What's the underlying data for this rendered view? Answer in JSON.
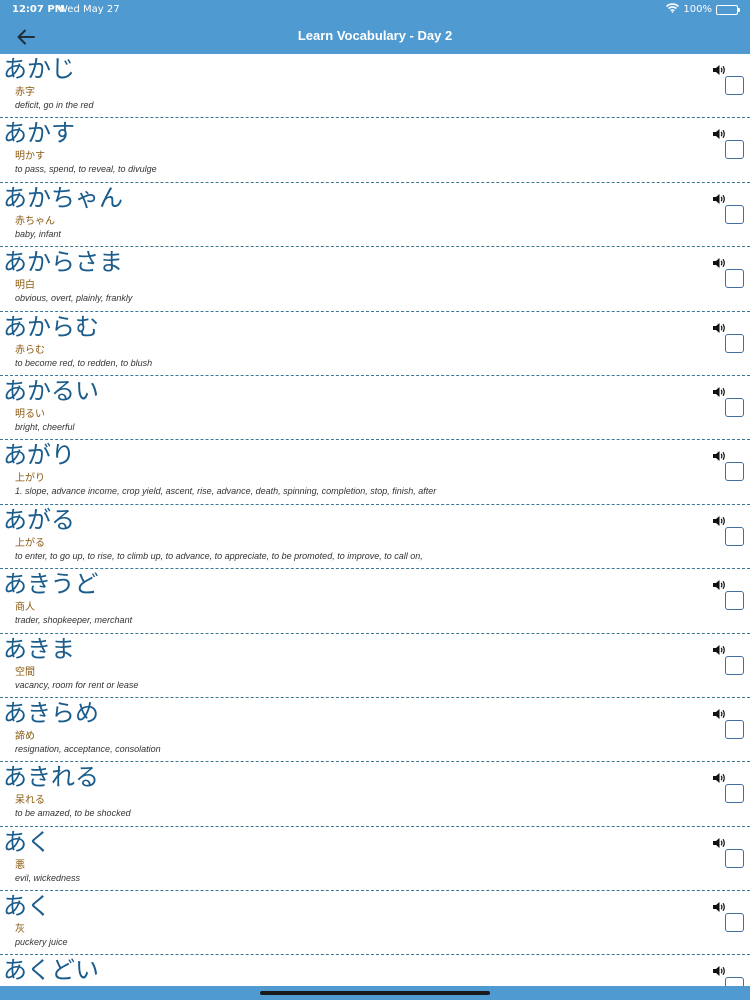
{
  "status": {
    "time": "12:07 PM",
    "date": "Wed May 27",
    "battery": "100%"
  },
  "header": {
    "title": "Learn Vocabulary - Day 2"
  },
  "words": [
    {
      "kana": "あかじ",
      "kanji": "赤字",
      "meaning": "deficit, go in the red"
    },
    {
      "kana": "あかす",
      "kanji": "明かす",
      "meaning": "to pass, spend, to reveal, to divulge"
    },
    {
      "kana": "あかちゃん",
      "kanji": "赤ちゃん",
      "meaning": "baby, infant"
    },
    {
      "kana": "あからさま",
      "kanji": "明白",
      "meaning": "obvious, overt, plainly, frankly"
    },
    {
      "kana": "あからむ",
      "kanji": "赤らむ",
      "meaning": "to become red, to redden, to blush"
    },
    {
      "kana": "あかるい",
      "kanji": "明るい",
      "meaning": "bright, cheerful"
    },
    {
      "kana": "あがり",
      "kanji": "上がり",
      "meaning": "1. slope, advance income, crop yield, ascent, rise, advance, death, spinning, completion, stop, finish, after"
    },
    {
      "kana": "あがる",
      "kanji": "上がる",
      "meaning": "to enter, to go up, to rise, to climb up, to advance, to appreciate, to be promoted, to improve, to call on,"
    },
    {
      "kana": "あきうど",
      "kanji": "商人",
      "meaning": "trader, shopkeeper, merchant"
    },
    {
      "kana": "あきま",
      "kanji": "空間",
      "meaning": "vacancy, room for rent or lease"
    },
    {
      "kana": "あきらめ",
      "kanji": "諦め",
      "meaning": "resignation, acceptance, consolation"
    },
    {
      "kana": "あきれる",
      "kanji": "呆れる",
      "meaning": "to be amazed, to be shocked"
    },
    {
      "kana": "あく",
      "kanji": "悪",
      "meaning": "evil, wickedness"
    },
    {
      "kana": "あく",
      "kanji": "灰",
      "meaning": "puckery juice"
    },
    {
      "kana": "あくどい",
      "kanji": "",
      "meaning": ""
    }
  ]
}
